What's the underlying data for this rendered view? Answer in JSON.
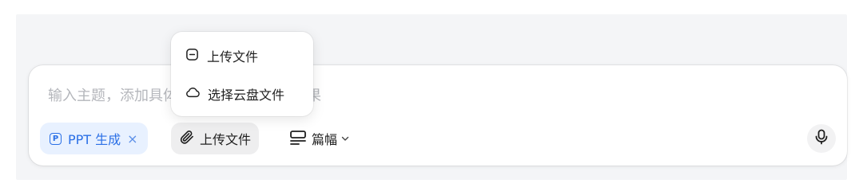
{
  "composer": {
    "placeholder": "输入主题，添加具体要求，以获得更好效果"
  },
  "toolbar": {
    "ppt_chip": {
      "icon_letter": "P",
      "label": "PPT 生成",
      "remove_symbol": "×"
    },
    "upload_button": {
      "icon": "paperclip-icon",
      "label": "上传文件"
    },
    "length_select": {
      "icon": "length-lines-icon",
      "label": "篇幅",
      "caret": "chevron-down-icon"
    },
    "mic_button": {
      "icon": "microphone-icon"
    }
  },
  "upload_menu": {
    "items": [
      {
        "icon": "local-file-icon",
        "label": "上传文件"
      },
      {
        "icon": "cloud-icon",
        "label": "选择云盘文件"
      }
    ]
  },
  "colors": {
    "accent": "#2a6fe6",
    "chip_bg": "#e8f1ff",
    "placeholder": "#b4b6bb"
  }
}
